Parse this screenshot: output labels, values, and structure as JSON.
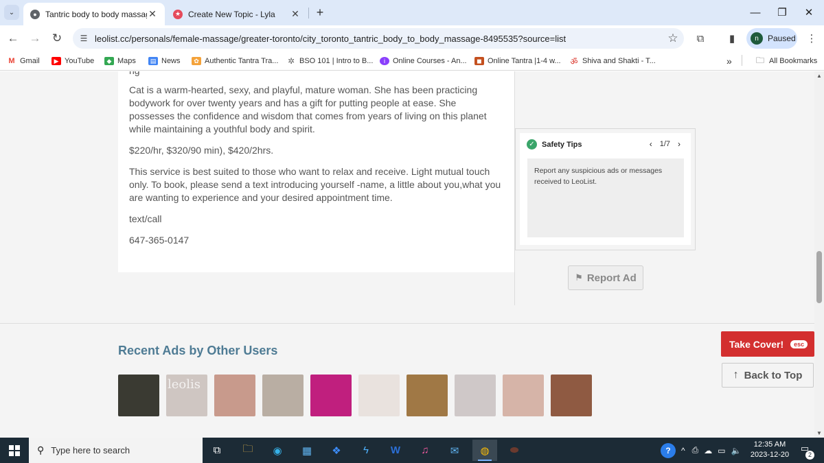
{
  "browser": {
    "tabs": [
      {
        "title": "Tantric body to body massage |",
        "active": true
      },
      {
        "title": "Create New Topic - Lyla",
        "active": false
      }
    ],
    "url": "leolist.cc/personals/female-massage/greater-toronto/city_toronto_tantric_body_to_body_massage-8495535?source=list",
    "profile_initial": "n",
    "profile_status": "Paused",
    "bookmarks": [
      {
        "label": "Gmail",
        "color": "#ea4335"
      },
      {
        "label": "YouTube",
        "color": "#ff0000"
      },
      {
        "label": "Maps",
        "color": "#34a853"
      },
      {
        "label": "News",
        "color": "#4285f4"
      },
      {
        "label": "Authentic Tantra Tra...",
        "color": "#f4a23a"
      },
      {
        "label": "BSO 101 | Intro to B...",
        "color": "#666666"
      },
      {
        "label": "Online Courses - An...",
        "color": "#8a3ffc"
      },
      {
        "label": "Online Tantra |1-4 w...",
        "color": "#c4501f"
      },
      {
        "label": "Shiva and Shakti - T...",
        "color": "#d93025"
      }
    ],
    "all_bookmarks": "All Bookmarks"
  },
  "listing": {
    "cut_line": "ng",
    "paragraphs": [
      "Cat is a warm-hearted, sexy, and playful, mature woman. She has been practicing bodywork for over twenty years and has a gift for putting people at ease. She possesses the confidence and wisdom that comes from years of living on this planet while maintaining a youthful body and spirit.",
      "$220/hr, $320/90 min), $420/2hrs.",
      "This service is best suited to those who want to relax and receive. Light mutual touch only. To book, please send a text introducing yourself -name, a little about you,what you are wanting to experience and your desired appointment time.",
      "text/call",
      "647-365-0147"
    ]
  },
  "safety": {
    "title": "Safety Tips",
    "page": "1/7",
    "text": "Report any suspicious ads or messages received to LeoList."
  },
  "report_label": "Report Ad",
  "recent": {
    "title": "Recent Ads by Other Users",
    "thumbs": [
      {
        "color": "#3a3a32",
        "wm": ""
      },
      {
        "color": "#cfc6c2",
        "wm": "leolis"
      },
      {
        "color": "#c89a8c",
        "wm": ""
      },
      {
        "color": "#b9aea3",
        "wm": ""
      },
      {
        "color": "#c01f7e",
        "wm": ""
      },
      {
        "color": "#e9e2de",
        "wm": ""
      },
      {
        "color": "#a07845",
        "wm": ""
      },
      {
        "color": "#cfc8c8",
        "wm": ""
      },
      {
        "color": "#d6b4a8",
        "wm": ""
      },
      {
        "color": "#8f5a42",
        "wm": ""
      }
    ]
  },
  "take_cover": {
    "label": "Take Cover!",
    "key": "esc"
  },
  "back_to_top": "Back to Top",
  "taskbar": {
    "search_placeholder": "Type here to search",
    "time": "12:35 AM",
    "date": "2023-12-20",
    "notifications": "2"
  }
}
